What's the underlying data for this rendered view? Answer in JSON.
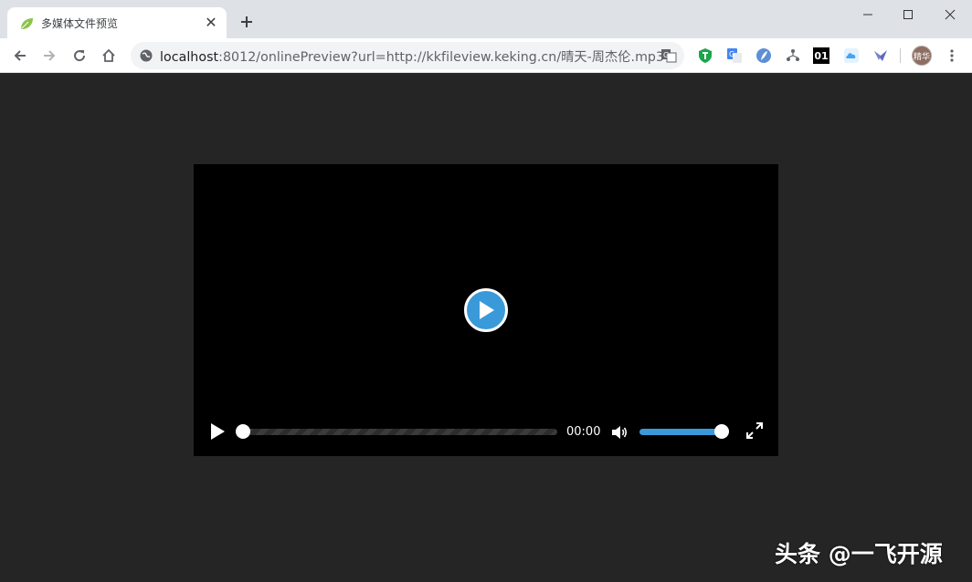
{
  "browser": {
    "tab": {
      "title": "多媒体文件预览",
      "favicon": "leaf-icon"
    },
    "new_tab_symbol": "+",
    "close_symbol": "✕",
    "address": {
      "host": "localhost",
      "rest": ":8012/onlinePreview?url=http://kkfileview.keking.cn/晴天-周杰伦.mp3"
    },
    "extensions": [
      "shield-extension-icon",
      "translate-extension-icon",
      "feather-extension-icon",
      "tree-extension-icon",
      "binary-extension-icon",
      "cloud-extension-icon",
      "bird-extension-icon"
    ],
    "extension_binary_label": "01",
    "avatar_label": "精华"
  },
  "player": {
    "time": "00:00",
    "progress": 0,
    "volume": 1.0,
    "accent_color": "#3a9ad9"
  },
  "watermark": "头条 @一飞开源"
}
